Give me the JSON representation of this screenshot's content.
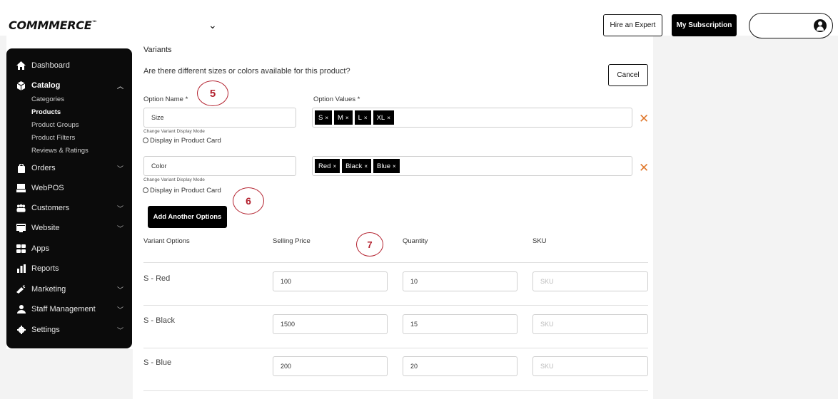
{
  "header": {
    "logo_text": "COMMMERCE",
    "logo_tm": "™",
    "store_chevron": "⌄",
    "hire_label": "Hire an Expert",
    "subscription_label": "My Subscription"
  },
  "sidebar": {
    "items": [
      {
        "id": "dashboard",
        "label": "Dashboard",
        "icon": "home-icon"
      },
      {
        "id": "catalog",
        "label": "Catalog",
        "icon": "catalog-icon",
        "expanded": true
      },
      {
        "id": "orders",
        "label": "Orders",
        "icon": "orders-icon"
      },
      {
        "id": "webpos",
        "label": "WebPOS",
        "icon": "pos-icon"
      },
      {
        "id": "customers",
        "label": "Customers",
        "icon": "customers-icon"
      },
      {
        "id": "website",
        "label": "Website",
        "icon": "website-icon"
      },
      {
        "id": "apps",
        "label": "Apps",
        "icon": "apps-icon"
      },
      {
        "id": "reports",
        "label": "Reports",
        "icon": "reports-icon"
      },
      {
        "id": "marketing",
        "label": "Marketing",
        "icon": "marketing-icon"
      },
      {
        "id": "staff",
        "label": "Staff Management",
        "icon": "staff-icon"
      },
      {
        "id": "settings",
        "label": "Settings",
        "icon": "settings-icon"
      }
    ],
    "catalog_sub": [
      "Categories",
      "Products",
      "Product Groups",
      "Product Filters",
      "Reviews & Ratings"
    ],
    "active_sub": "Products"
  },
  "variants": {
    "heading": "Variants",
    "question": "Are there different sizes or colors available for this product?",
    "cancel_label": "Cancel",
    "option_name_label": "Option Name *",
    "option_values_label": "Option Values *",
    "options": [
      {
        "name": "Size",
        "values": [
          "S",
          "M",
          "L",
          "XL"
        ]
      },
      {
        "name": "Color",
        "values": [
          "Red",
          "Black",
          "Blue"
        ]
      }
    ],
    "tag_remove_glyph": "×",
    "remove_glyph": "✕",
    "change_mode_label": "Change Variant Display Mode",
    "display_card_label": "Display in Product Card",
    "add_option_label": "Add Another Options"
  },
  "variant_table": {
    "headers": [
      "Variant Options",
      "Selling Price",
      "Quantity",
      "SKU"
    ],
    "sku_placeholder": "SKU",
    "rows": [
      {
        "variant": "S - Red",
        "price": "100",
        "quantity": "10"
      },
      {
        "variant": "S - Black",
        "price": "1500",
        "quantity": "15"
      },
      {
        "variant": "S - Blue",
        "price": "200",
        "quantity": "20"
      }
    ]
  },
  "callouts": [
    "5",
    "6",
    "7"
  ],
  "colors": {
    "accent_dark": "#000000",
    "remove_orange": "#e07a2f",
    "callout_red": "#b3212e"
  }
}
